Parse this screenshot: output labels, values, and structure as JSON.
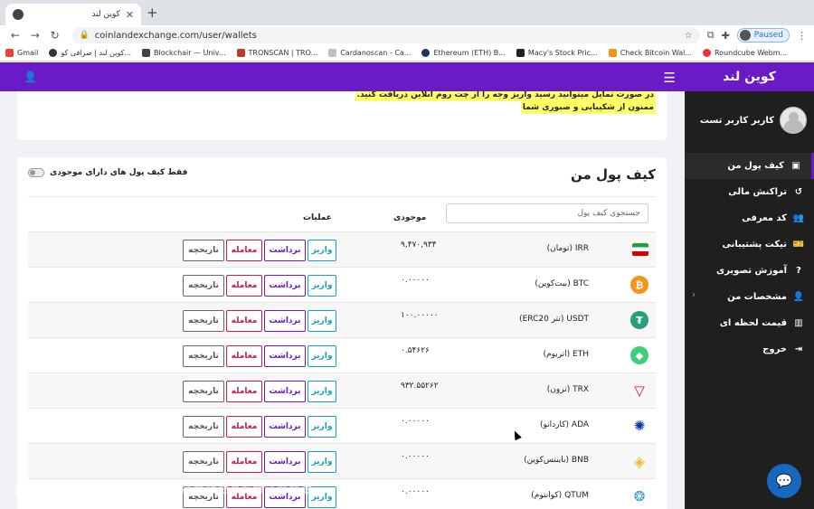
{
  "browser": {
    "tab_title": "کوین لند",
    "url": "coinlandexchange.com/user/wallets",
    "profile_status": "Paused",
    "bookmarks": [
      "Gmail",
      "کوین لند | صرافی کو...",
      "Blockchair — Univ...",
      "TRONSCAN | TRO...",
      "Cardanoscan - Ca...",
      "Ethereum (ETH) B...",
      "Macy's Stock Pric...",
      "Check Bitcoin Wal...",
      "Roundcube Webm..."
    ]
  },
  "sidebar": {
    "brand": "کوین لند",
    "user_name": "کاربر کاربر تست",
    "items": [
      {
        "label": "کیف پول من",
        "icon": "wallet-icon"
      },
      {
        "label": "تراکنش مالی",
        "icon": "history-icon"
      },
      {
        "label": "کد معرفی",
        "icon": "users-icon"
      },
      {
        "label": "تیکت پشتیبانی",
        "icon": "ticket-icon"
      },
      {
        "label": "آموزش تصویری",
        "icon": "question-icon"
      },
      {
        "label": "مشخصات من",
        "icon": "user-icon"
      },
      {
        "label": "قیمت لحظه ای",
        "icon": "bar-chart-icon"
      },
      {
        "label": "خروج",
        "icon": "sign-out-icon"
      }
    ]
  },
  "notice": {
    "line1": "در صورت تمایل میتوانید رسید واریز وجه را از چت روم انلاین دریافت کنید.",
    "line2": "ممنون از شکیبایی و صبوری شما"
  },
  "wallet": {
    "title": "کیف پول من",
    "filter_label": "فقط کیف پول های دارای موجودی",
    "search_placeholder": "جستجوی کیف پول",
    "col_balance": "موجودی",
    "col_ops": "عملیات",
    "btn_deposit": "واریز",
    "btn_withdraw": "برداشت",
    "btn_trade": "معامله",
    "btn_history": "تاریخچه",
    "coins": [
      {
        "name": "IRR (تومان)",
        "balance": "۹,۴۷۰,۹۳۴",
        "color": "#ffffff"
      },
      {
        "name": "BTC (بیت‌کوین)",
        "balance": "۰.۰۰۰۰۰",
        "color": "#f7931a"
      },
      {
        "name": "USDT (تتر ERC20)",
        "balance": "۱۰۰.۰۰۰۰۰",
        "color": "#26a17b"
      },
      {
        "name": "ETH (اتریوم)",
        "balance": "۰.۵۴۶۲۶",
        "color": "#3ecf7d"
      },
      {
        "name": "TRX (ترون)",
        "balance": "۹۳۲.۵۵۲۶۲",
        "color": "#ef0027"
      },
      {
        "name": "ADA (کاردانو)",
        "balance": "۰.۰۰۰۰۰",
        "color": "#0033ad"
      },
      {
        "name": "BNB (بایننس‌کوین)",
        "balance": "۰.۰۰۰۰۰",
        "color": "#f3ba2f"
      },
      {
        "name": "QTUM (کوانتوم)",
        "balance": "۰.۰۰۰۰۰",
        "color": "#2e9ad0"
      }
    ]
  },
  "watermark": "aparat.com/coinlandexchange"
}
